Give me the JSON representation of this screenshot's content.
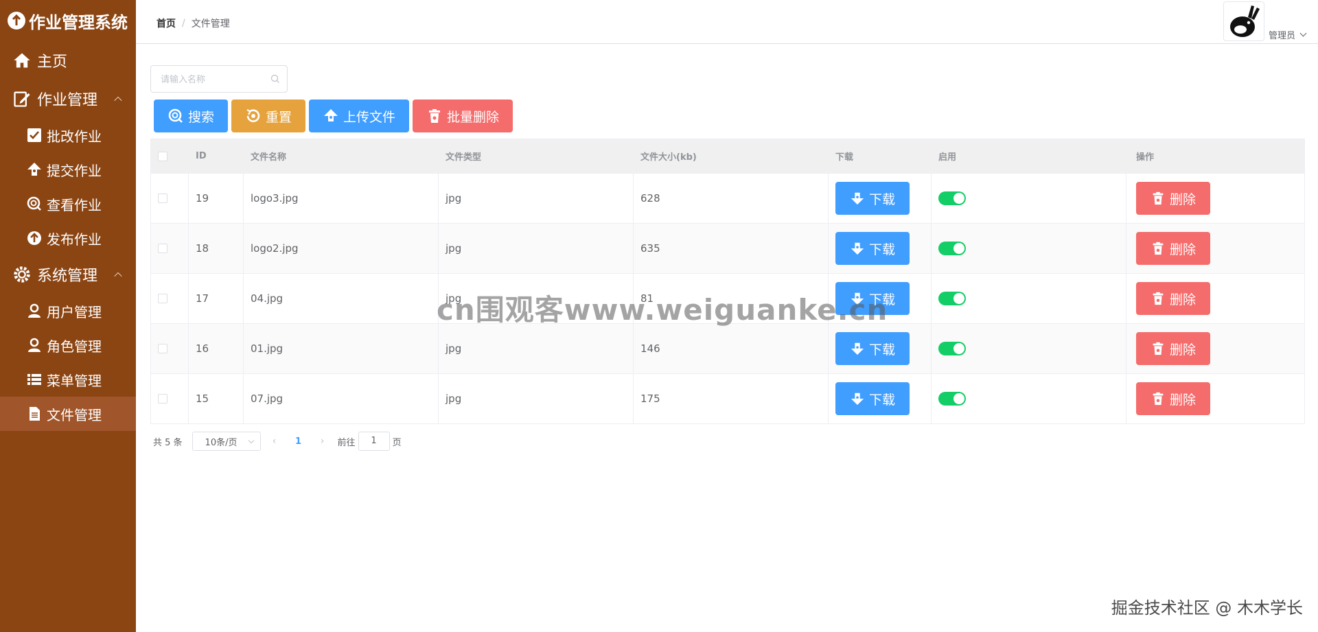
{
  "app": {
    "title": "作业管理系统"
  },
  "sidebar": {
    "items": [
      {
        "label": "主页",
        "icon": "home-icon",
        "level": "top"
      },
      {
        "label": "作业管理",
        "icon": "edit-icon",
        "level": "top",
        "expanded": true
      },
      {
        "label": "批改作业",
        "icon": "check-square-icon",
        "level": "sub"
      },
      {
        "label": "提交作业",
        "icon": "upload-icon",
        "level": "sub"
      },
      {
        "label": "查看作业",
        "icon": "search-icon",
        "level": "sub"
      },
      {
        "label": "发布作业",
        "icon": "publish-icon",
        "level": "sub"
      },
      {
        "label": "系统管理",
        "icon": "gear-icon",
        "level": "top",
        "expanded": true
      },
      {
        "label": "用户管理",
        "icon": "user-icon",
        "level": "sub"
      },
      {
        "label": "角色管理",
        "icon": "role-icon",
        "level": "sub"
      },
      {
        "label": "菜单管理",
        "icon": "list-icon",
        "level": "sub"
      },
      {
        "label": "文件管理",
        "icon": "file-icon",
        "level": "sub",
        "active": true
      }
    ]
  },
  "header": {
    "breadcrumb": {
      "home": "首页",
      "separator": "/",
      "current": "文件管理"
    },
    "user": {
      "name": "管理员"
    }
  },
  "search": {
    "placeholder": "请输入名称",
    "value": ""
  },
  "toolbar": {
    "search_label": "搜索",
    "reset_label": "重置",
    "upload_label": "上传文件",
    "batch_delete_label": "批量删除"
  },
  "table": {
    "headers": {
      "id": "ID",
      "name": "文件名称",
      "type": "文件类型",
      "size": "文件大小(kb)",
      "download": "下载",
      "enabled": "启用",
      "actions": "操作"
    },
    "download_label": "下载",
    "delete_label": "删除",
    "rows": [
      {
        "id": "19",
        "name": "logo3.jpg",
        "type": "jpg",
        "size": "628",
        "enabled": true
      },
      {
        "id": "18",
        "name": "logo2.jpg",
        "type": "jpg",
        "size": "635",
        "enabled": true
      },
      {
        "id": "17",
        "name": "04.jpg",
        "type": "jpg",
        "size": "81",
        "enabled": true
      },
      {
        "id": "16",
        "name": "01.jpg",
        "type": "jpg",
        "size": "146",
        "enabled": true
      },
      {
        "id": "15",
        "name": "07.jpg",
        "type": "jpg",
        "size": "175",
        "enabled": true
      }
    ]
  },
  "pagination": {
    "total": "共 5 条",
    "page_size": "10条/页",
    "current_page": "1",
    "goto_prefix": "前往",
    "goto_value": "1",
    "goto_suffix": "页"
  },
  "watermarks": {
    "center": "cn围观客www.weiguanke.cn",
    "corner": "掘金技术社区 @ 木木学长"
  },
  "colors": {
    "sidebar_bg": "#8b4513",
    "primary": "#409eff",
    "warning": "#e6a23c",
    "danger": "#f56c6c",
    "switch_on": "#13ce66"
  }
}
